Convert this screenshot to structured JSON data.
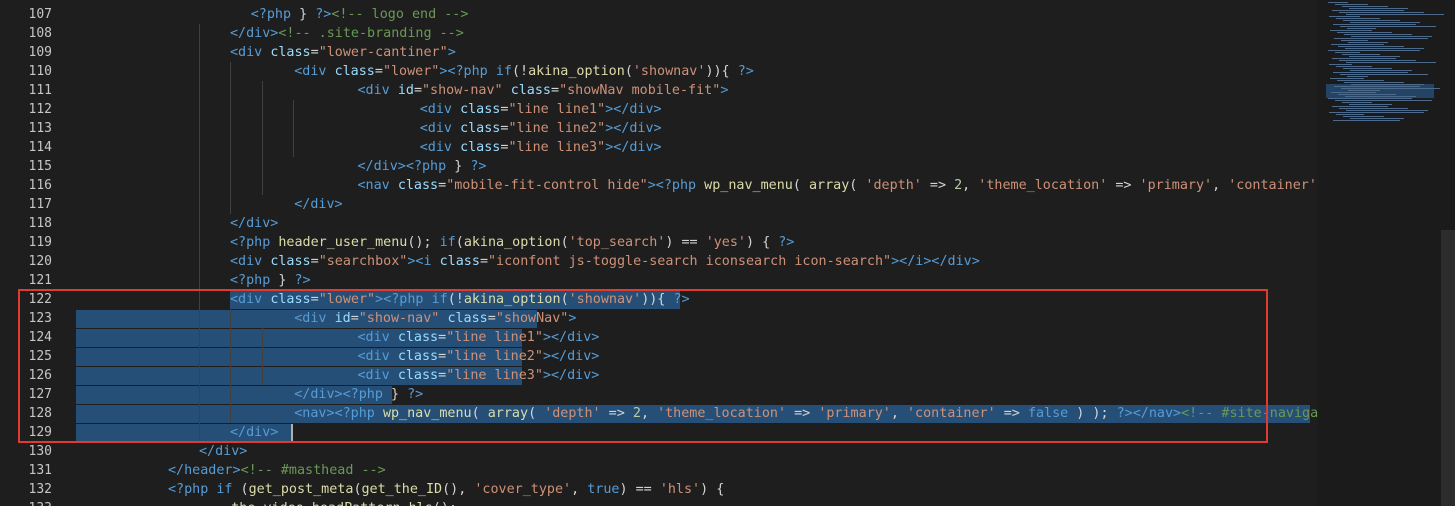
{
  "editor": {
    "lines": [
      {
        "n": "107",
        "tokens": [
          [
            "punct",
            "            "
          ],
          [
            "php",
            "<?php"
          ],
          [
            "punct",
            " } "
          ],
          [
            "php",
            "?>"
          ],
          [
            "cmt",
            "<!-- logo end -->"
          ]
        ]
      },
      {
        "n": "108",
        "tokens": [
          [
            "tag",
            "</div>"
          ],
          [
            "cmt",
            "<!-- .site-branding -->"
          ]
        ]
      },
      {
        "n": "109",
        "tokens": [
          [
            "tag",
            "<div"
          ],
          [
            "punct",
            " "
          ],
          [
            "attr",
            "class"
          ],
          [
            "punct",
            "="
          ],
          [
            "str",
            "\"lower-cantiner\""
          ],
          [
            "tag",
            ">"
          ]
        ]
      },
      {
        "n": "110",
        "tokens": [
          [
            "punct",
            "    "
          ],
          [
            "tag",
            "<div"
          ],
          [
            "punct",
            " "
          ],
          [
            "attr",
            "class"
          ],
          [
            "punct",
            "="
          ],
          [
            "str",
            "\"lower\""
          ],
          [
            "tag",
            ">"
          ],
          [
            "php",
            "<?php"
          ],
          [
            "punct",
            " "
          ],
          [
            "kw",
            "if"
          ],
          [
            "punct",
            "(!"
          ],
          [
            "fn",
            "akina_option"
          ],
          [
            "punct",
            "("
          ],
          [
            "str",
            "'shownav'"
          ],
          [
            "punct",
            ")){ "
          ],
          [
            "php",
            "?>"
          ]
        ]
      },
      {
        "n": "111",
        "tokens": [
          [
            "punct",
            "        "
          ],
          [
            "tag",
            "<div"
          ],
          [
            "punct",
            " "
          ],
          [
            "attr",
            "id"
          ],
          [
            "punct",
            "="
          ],
          [
            "str",
            "\"show-nav\""
          ],
          [
            "punct",
            " "
          ],
          [
            "attr",
            "class"
          ],
          [
            "punct",
            "="
          ],
          [
            "str",
            "\"showNav mobile-fit\""
          ],
          [
            "tag",
            ">"
          ]
        ]
      },
      {
        "n": "112",
        "tokens": [
          [
            "punct",
            "            "
          ],
          [
            "tag",
            "<div"
          ],
          [
            "punct",
            " "
          ],
          [
            "attr",
            "class"
          ],
          [
            "punct",
            "="
          ],
          [
            "str",
            "\"line line1\""
          ],
          [
            "tag",
            "></div>"
          ]
        ]
      },
      {
        "n": "113",
        "tokens": [
          [
            "punct",
            "            "
          ],
          [
            "tag",
            "<div"
          ],
          [
            "punct",
            " "
          ],
          [
            "attr",
            "class"
          ],
          [
            "punct",
            "="
          ],
          [
            "str",
            "\"line line2\""
          ],
          [
            "tag",
            "></div>"
          ]
        ]
      },
      {
        "n": "114",
        "tokens": [
          [
            "punct",
            "            "
          ],
          [
            "tag",
            "<div"
          ],
          [
            "punct",
            " "
          ],
          [
            "attr",
            "class"
          ],
          [
            "punct",
            "="
          ],
          [
            "str",
            "\"line line3\""
          ],
          [
            "tag",
            "></div>"
          ]
        ]
      },
      {
        "n": "115",
        "tokens": [
          [
            "punct",
            "        "
          ],
          [
            "tag",
            "</div>"
          ],
          [
            "php",
            "<?php"
          ],
          [
            "punct",
            " } "
          ],
          [
            "php",
            "?>"
          ]
        ]
      },
      {
        "n": "116",
        "tokens": [
          [
            "punct",
            "        "
          ],
          [
            "tag",
            "<nav"
          ],
          [
            "punct",
            " "
          ],
          [
            "attr",
            "class"
          ],
          [
            "punct",
            "="
          ],
          [
            "str",
            "\"mobile-fit-control hide\""
          ],
          [
            "tag",
            ">"
          ],
          [
            "php",
            "<?php"
          ],
          [
            "punct",
            " "
          ],
          [
            "fn",
            "wp_nav_menu"
          ],
          [
            "punct",
            "( "
          ],
          [
            "fn",
            "array"
          ],
          [
            "punct",
            "( "
          ],
          [
            "str",
            "'depth'"
          ],
          [
            "punct",
            " => "
          ],
          [
            "num",
            "2"
          ],
          [
            "punct",
            ", "
          ],
          [
            "str",
            "'theme_location'"
          ],
          [
            "punct",
            " => "
          ],
          [
            "str",
            "'primary'"
          ],
          [
            "punct",
            ", "
          ],
          [
            "str",
            "'container'"
          ],
          [
            "punct",
            " => "
          ],
          [
            "bool",
            "false"
          ],
          [
            "punct",
            " ) );"
          ]
        ]
      },
      {
        "n": "117",
        "tokens": [
          [
            "punct",
            "    "
          ],
          [
            "tag",
            "</div>"
          ]
        ]
      },
      {
        "n": "118",
        "tokens": [
          [
            "tag",
            "</div>"
          ]
        ]
      },
      {
        "n": "119",
        "tokens": [
          [
            "php",
            "<?php"
          ],
          [
            "punct",
            " "
          ],
          [
            "fn",
            "header_user_menu"
          ],
          [
            "punct",
            "(); "
          ],
          [
            "kw",
            "if"
          ],
          [
            "punct",
            "("
          ],
          [
            "fn",
            "akina_option"
          ],
          [
            "punct",
            "("
          ],
          [
            "str",
            "'top_search'"
          ],
          [
            "punct",
            ") == "
          ],
          [
            "str",
            "'yes'"
          ],
          [
            "punct",
            ") { "
          ],
          [
            "php",
            "?>"
          ]
        ]
      },
      {
        "n": "120",
        "tokens": [
          [
            "tag",
            "<div"
          ],
          [
            "punct",
            " "
          ],
          [
            "attr",
            "class"
          ],
          [
            "punct",
            "="
          ],
          [
            "str",
            "\"searchbox\""
          ],
          [
            "tag",
            "><i"
          ],
          [
            "punct",
            " "
          ],
          [
            "attr",
            "class"
          ],
          [
            "punct",
            "="
          ],
          [
            "str",
            "\"iconfont js-toggle-search iconsearch icon-search\""
          ],
          [
            "tag",
            "></i></div>"
          ]
        ]
      },
      {
        "n": "121",
        "tokens": [
          [
            "php",
            "<?php"
          ],
          [
            "punct",
            " } "
          ],
          [
            "php",
            "?>"
          ]
        ]
      },
      {
        "n": "122",
        "tokens": [
          [
            "tag",
            "<div"
          ],
          [
            "punct",
            " "
          ],
          [
            "attr",
            "class"
          ],
          [
            "punct",
            "="
          ],
          [
            "str",
            "\"lower\""
          ],
          [
            "tag",
            ">"
          ],
          [
            "php",
            "<?php"
          ],
          [
            "punct",
            " "
          ],
          [
            "kw",
            "if"
          ],
          [
            "punct",
            "(!"
          ],
          [
            "fn",
            "akina_option"
          ],
          [
            "punct",
            "("
          ],
          [
            "str",
            "'shownav'"
          ],
          [
            "punct",
            ")){ "
          ],
          [
            "php",
            "?>"
          ]
        ]
      },
      {
        "n": "123",
        "tokens": [
          [
            "punct",
            "    "
          ],
          [
            "tag",
            "<div"
          ],
          [
            "punct",
            " "
          ],
          [
            "attr",
            "id"
          ],
          [
            "punct",
            "="
          ],
          [
            "str",
            "\"show-nav\""
          ],
          [
            "punct",
            " "
          ],
          [
            "attr",
            "class"
          ],
          [
            "punct",
            "="
          ],
          [
            "str",
            "\"showNav\""
          ],
          [
            "tag",
            ">"
          ]
        ]
      },
      {
        "n": "124",
        "tokens": [
          [
            "punct",
            "        "
          ],
          [
            "tag",
            "<div"
          ],
          [
            "punct",
            " "
          ],
          [
            "attr",
            "class"
          ],
          [
            "punct",
            "="
          ],
          [
            "str",
            "\"line line1\""
          ],
          [
            "tag",
            "></div>"
          ]
        ]
      },
      {
        "n": "125",
        "tokens": [
          [
            "punct",
            "        "
          ],
          [
            "tag",
            "<div"
          ],
          [
            "punct",
            " "
          ],
          [
            "attr",
            "class"
          ],
          [
            "punct",
            "="
          ],
          [
            "str",
            "\"line line2\""
          ],
          [
            "tag",
            "></div>"
          ]
        ]
      },
      {
        "n": "126",
        "tokens": [
          [
            "punct",
            "        "
          ],
          [
            "tag",
            "<div"
          ],
          [
            "punct",
            " "
          ],
          [
            "attr",
            "class"
          ],
          [
            "punct",
            "="
          ],
          [
            "str",
            "\"line line3\""
          ],
          [
            "tag",
            "></div>"
          ]
        ]
      },
      {
        "n": "127",
        "tokens": [
          [
            "punct",
            "    "
          ],
          [
            "tag",
            "</div>"
          ],
          [
            "php",
            "<?php"
          ],
          [
            "punct",
            " } "
          ],
          [
            "php",
            "?>"
          ]
        ]
      },
      {
        "n": "128",
        "tokens": [
          [
            "punct",
            "    "
          ],
          [
            "tag",
            "<nav>"
          ],
          [
            "php",
            "<?php"
          ],
          [
            "punct",
            " "
          ],
          [
            "fn",
            "wp_nav_menu"
          ],
          [
            "punct",
            "( "
          ],
          [
            "fn",
            "array"
          ],
          [
            "punct",
            "( "
          ],
          [
            "str",
            "'depth'"
          ],
          [
            "punct",
            " => "
          ],
          [
            "num",
            "2"
          ],
          [
            "punct",
            ", "
          ],
          [
            "str",
            "'theme_location'"
          ],
          [
            "punct",
            " => "
          ],
          [
            "str",
            "'primary'"
          ],
          [
            "punct",
            ", "
          ],
          [
            "str",
            "'container'"
          ],
          [
            "punct",
            " => "
          ],
          [
            "bool",
            "false"
          ],
          [
            "punct",
            " ) ); "
          ],
          [
            "php",
            "?>"
          ],
          [
            "tag",
            "</nav>"
          ],
          [
            "cmt",
            "<!-- #site-navigation -->"
          ]
        ]
      },
      {
        "n": "129",
        "tokens": [
          [
            "tag",
            "</div>"
          ]
        ]
      },
      {
        "n": "130",
        "tokens": [
          [
            "tag",
            "</div>"
          ]
        ]
      },
      {
        "n": "131",
        "tokens": [
          [
            "tag",
            "</header>"
          ],
          [
            "cmt",
            "<!-- #masthead -->"
          ]
        ]
      },
      {
        "n": "132",
        "tokens": [
          [
            "php",
            "<?php"
          ],
          [
            "punct",
            " "
          ],
          [
            "kw",
            "if"
          ],
          [
            "punct",
            " ("
          ],
          [
            "fn",
            "get_post_meta"
          ],
          [
            "punct",
            "("
          ],
          [
            "fn",
            "get_the_ID"
          ],
          [
            "punct",
            "(), "
          ],
          [
            "str",
            "'cover_type'"
          ],
          [
            "punct",
            ", "
          ],
          [
            "bool",
            "true"
          ],
          [
            "punct",
            ") == "
          ],
          [
            "str",
            "'hls'"
          ],
          [
            "punct",
            ") {"
          ]
        ]
      },
      {
        "n": "133",
        "tokens": [
          [
            "punct",
            "    "
          ],
          [
            "fn",
            "the_video_headPattern_hls"
          ],
          [
            "punct",
            "();"
          ]
        ]
      }
    ]
  },
  "colors": {
    "background": "#1e1e1e",
    "selection": "#264f78",
    "highlight_box": "#e03b32"
  },
  "icons": {
    "mascot": "marisa-chibi-image"
  }
}
